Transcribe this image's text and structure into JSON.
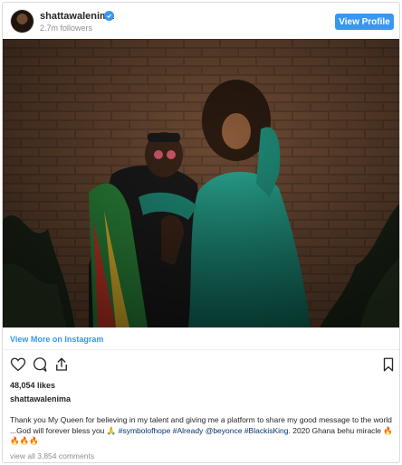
{
  "header": {
    "username": "shattawalenima",
    "followers": "2.7m followers",
    "view_profile_label": "View Profile"
  },
  "post": {
    "view_more_label": "View More on Instagram",
    "likes": "48,054 likes",
    "owner": "shattawalenima",
    "caption_text": "Thank you My Queen for believing in my talent and giving me a platform to share my good message to the world ...God will forever bless you 🙏 ",
    "caption_tags": [
      "#symbolofhope",
      "#Already",
      "@beyonce",
      "#BlackisKing."
    ],
    "caption_tail": " 2020 Ghana behu miracle 🔥🔥🔥🔥",
    "view_all_comments": "view all 3,854 comments"
  },
  "colors": {
    "accent": "#3897f0",
    "text": "#262626",
    "muted": "#8e8e8e",
    "tag": "#003569"
  }
}
